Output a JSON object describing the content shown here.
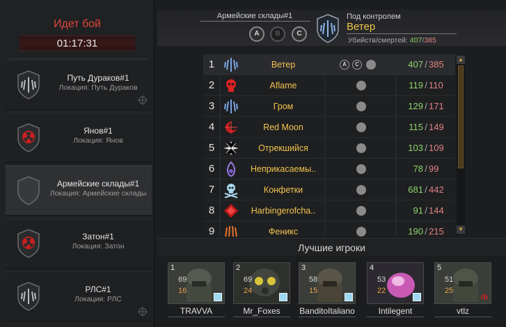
{
  "battle": {
    "title": "Идет бой",
    "timer": "01:17:31"
  },
  "locations": [
    {
      "name": "Путь Дураков#1",
      "sub": "Локация: Путь Дураков",
      "emblem": "wings-emblem-icon",
      "active": false,
      "corner": true
    },
    {
      "name": "Янов#1",
      "sub": "Локация: Янов",
      "emblem": "radiation-emblem-icon",
      "active": false,
      "corner": false
    },
    {
      "name": "Армейские склады#1",
      "sub": "Локация: Армейские склады",
      "emblem": "empty-shield-icon",
      "active": true,
      "corner": false
    },
    {
      "name": "Затон#1",
      "sub": "Локация: Затон",
      "emblem": "radiation-emblem-icon",
      "active": false,
      "corner": false
    },
    {
      "name": "РЛС#1",
      "sub": "Локация: РЛС",
      "emblem": "wings-emblem-icon",
      "active": false,
      "corner": true
    }
  ],
  "header": {
    "caption": "Армейские склады#1",
    "points": [
      "A",
      "B",
      "C"
    ],
    "control_caption": "Под контролем",
    "control_name": "Ветер",
    "stats_label": "Убийств/смертей:",
    "kills": "407",
    "deaths": "385"
  },
  "clans": [
    {
      "rank": "1",
      "name": "Ветер",
      "kills": "407",
      "deaths": "385",
      "points": [
        "A",
        "C"
      ],
      "emblem": "blue-wings-icon"
    },
    {
      "rank": "2",
      "name": "Aflame",
      "kills": "119",
      "deaths": "110",
      "points": [],
      "emblem": "red-skull-icon"
    },
    {
      "rank": "3",
      "name": "Гром",
      "kills": "129",
      "deaths": "171",
      "points": [],
      "emblem": "blue-wings-icon"
    },
    {
      "rank": "4",
      "name": "Red Moon",
      "kills": "115",
      "deaths": "149",
      "points": [],
      "emblem": "red-moon-icon"
    },
    {
      "rank": "5",
      "name": "Отрекшийся",
      "kills": "103",
      "deaths": "109",
      "points": [],
      "emblem": "star-compass-icon"
    },
    {
      "rank": "6",
      "name": "Неприкасаемы..",
      "kills": "78",
      "deaths": "99",
      "points": [],
      "emblem": "purple-fire-icon"
    },
    {
      "rank": "7",
      "name": "Конфетки",
      "kills": "681",
      "deaths": "442",
      "points": [],
      "emblem": "skull-crossbones-icon"
    },
    {
      "rank": "8",
      "name": "Harbingerofcha..",
      "kills": "91",
      "deaths": "144",
      "points": [],
      "emblem": "red-diamond-icon"
    },
    {
      "rank": "9",
      "name": "Феникс",
      "kills": "190",
      "deaths": "215",
      "points": [],
      "emblem": "phoenix-icon"
    }
  ],
  "best_title": "Лучшие игроки",
  "players": [
    {
      "num": "1",
      "kills": "69",
      "deaths": "16",
      "name": "TRAVVA",
      "art": "soldier-helmet"
    },
    {
      "num": "2",
      "kills": "69",
      "deaths": "24",
      "name": "Mr_Foxes",
      "art": "gas-mask"
    },
    {
      "num": "3",
      "kills": "58",
      "deaths": "15",
      "name": "BanditoItaliano",
      "art": "soldier-helmet"
    },
    {
      "num": "4",
      "kills": "53",
      "deaths": "22",
      "name": "Intilegent",
      "art": "pink-blob"
    },
    {
      "num": "5",
      "kills": "51",
      "deaths": "25",
      "name": "vtlz",
      "art": "soldier-helmet"
    }
  ],
  "colors": {
    "accent_gold": "#f1c44e",
    "kills_green": "#8fd36b",
    "deaths_red": "#e08383",
    "battle_red": "#e0463a"
  }
}
